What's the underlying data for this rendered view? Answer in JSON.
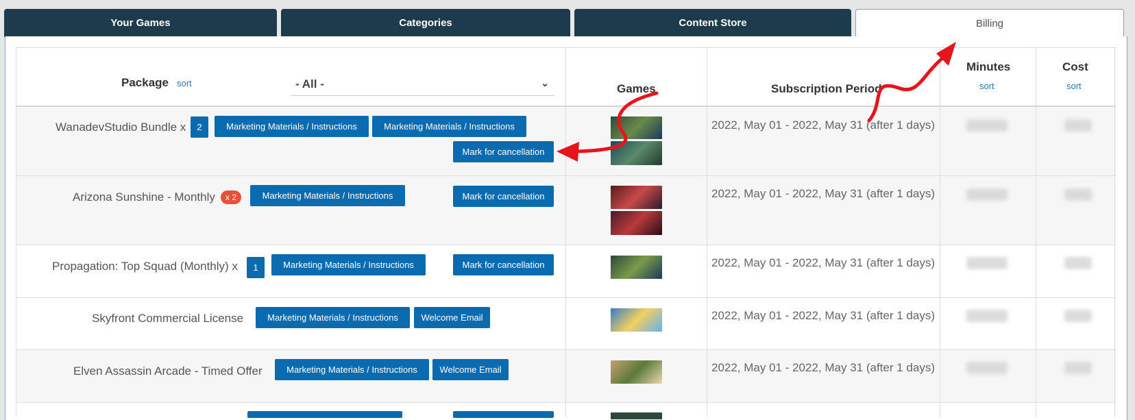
{
  "tabs": [
    {
      "label": "Your Games"
    },
    {
      "label": "Categories"
    },
    {
      "label": "Content Store"
    },
    {
      "label": "Billing"
    }
  ],
  "table": {
    "columns": {
      "package": "Package",
      "sort": "sort",
      "games": "Games",
      "period": "Subscription Period",
      "minutes": "Minutes",
      "cost": "Cost"
    },
    "filter_value": "- All -",
    "rows": [
      {
        "package": "WanadevStudio Bundle x",
        "quantity": "2",
        "buttons": [
          "Marketing Materials / Instructions",
          "Marketing Materials / Instructions",
          "Mark for cancellation"
        ],
        "period": "2022, May 01 - 2022, May 31 (after 1 days)"
      },
      {
        "package": "Arizona Sunshine - Monthly",
        "quantity": "x 2",
        "buttons": [
          "Marketing Materials / Instructions",
          "Mark for cancellation"
        ],
        "period": "2022, May 01 - 2022, May 31 (after 1 days)"
      },
      {
        "package": "Propagation: Top Squad (Monthly) x",
        "quantity": "1",
        "buttons": [
          "Marketing Materials / Instructions",
          "Mark for cancellation"
        ],
        "period": "2022, May 01 - 2022, May 31 (after 1 days)"
      },
      {
        "package": "Skyfront Commercial License",
        "buttons": [
          "Marketing Materials / Instructions",
          "Welcome Email"
        ],
        "period": "2022, May 01 - 2022, May 31 (after 1 days)"
      },
      {
        "package": "Elven Assassin Arcade - Timed Offer",
        "buttons": [
          "Marketing Materials / Instructions",
          "Welcome Email"
        ],
        "period": "2022, May 01 - 2022, May 31 (after 1 days)"
      }
    ]
  },
  "colors": {
    "tab_bg": "#1e3b4b",
    "button_blue": "#0b6bb0",
    "badge_red": "#e8503a",
    "annotation_red": "#e8141c"
  },
  "icons": {
    "dropdown": "chevron-down-icon",
    "annotation": "red-arrow-annotation"
  }
}
